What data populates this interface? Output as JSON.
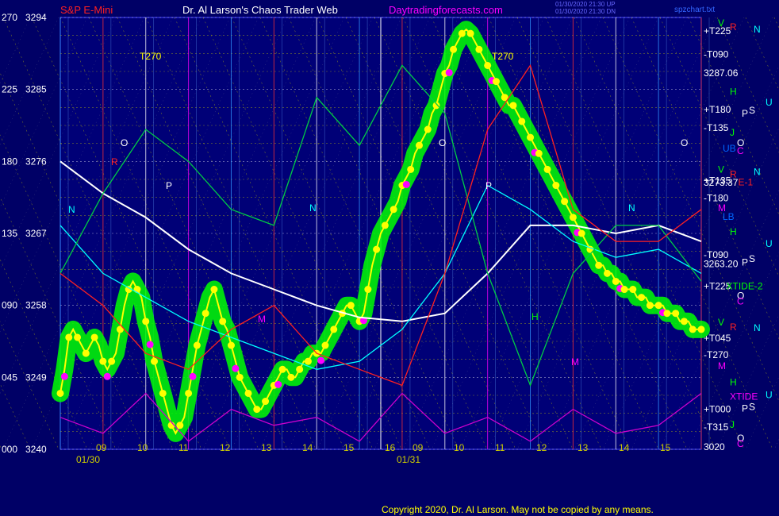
{
  "header": {
    "symbol": "S&P E-Mini",
    "title": "Dr. Al Larson's Chaos Trader Web",
    "site": "Daytradingforecasts.com",
    "timestamp_line1": "01/30/2020 21:30 UP",
    "timestamp_line2": "01/30/2020 21:30 DN",
    "file": "spzchart.txt"
  },
  "footer": {
    "copyright": "Copyright 2020, Dr. Al Larson. May not be copied by any means."
  },
  "colors": {
    "background": "#000066",
    "price_yellow": "#ffff00",
    "trend_green": "#00ff00",
    "avg_white": "#ffffff",
    "avg_cyan": "#00ffff",
    "magenta": "#ff00ff",
    "red": "#ff2020",
    "grid_yellow": "#c8c800",
    "vline_blue": "#3399ff",
    "vline_red": "#ff3030"
  },
  "chart_data": {
    "type": "line",
    "title": "S&P E-Mini",
    "ylim": [
      3240,
      3294
    ],
    "y_ticks_price": [
      "3294",
      "3285",
      "3276",
      "3267",
      "3258",
      "3249",
      "3240"
    ],
    "y_ticks_degrees": [
      "270",
      "225",
      "180",
      "135",
      "090",
      "045",
      "000"
    ],
    "x_date_labels": [
      "01/30",
      "01/31"
    ],
    "x_hour_labels_day1": [
      "09",
      "10",
      "11",
      "12",
      "13",
      "14",
      "15",
      "16"
    ],
    "x_hour_labels_day2": [
      "09",
      "10",
      "11",
      "12",
      "13",
      "14",
      "15"
    ],
    "right_labels": [
      {
        "text": "+T225",
        "price": 3292.3,
        "color": "#ffffff"
      },
      {
        "text": "-T090",
        "price": 3289.4,
        "color": "#ffffff"
      },
      {
        "text": "3287.06",
        "price": 3287.06,
        "color": "#ffffff"
      },
      {
        "text": "+T180",
        "price": 3282.5,
        "color": "#ffffff"
      },
      {
        "text": "-T135",
        "price": 3280.2,
        "color": "#ffffff"
      },
      {
        "text": "3273.37",
        "price": 3273.37,
        "color": "#ffffff"
      },
      {
        "text": "+T135",
        "price": 3273.6,
        "color": "#ffffff"
      },
      {
        "text": "-T180",
        "price": 3271.4,
        "color": "#ffffff"
      },
      {
        "text": "3263.20",
        "price": 3263.2,
        "color": "#ffffff"
      },
      {
        "text": "-T090",
        "price": 3264.3,
        "color": "#ffffff"
      },
      {
        "text": "+T225",
        "price": 3260.4,
        "color": "#ffffff"
      },
      {
        "text": "+T045",
        "price": 3253.9,
        "color": "#ffffff"
      },
      {
        "text": "-T270",
        "price": 3251.8,
        "color": "#ffffff"
      },
      {
        "text": "+T000",
        "price": 3245.0,
        "color": "#ffffff"
      },
      {
        "text": "-T315",
        "price": 3242.8,
        "color": "#ffffff"
      },
      {
        "text": "3020",
        "price": 3240.3,
        "color": "#ffffff"
      }
    ],
    "right_letters": [
      {
        "text": "V",
        "price": 3293.3,
        "color": "#00ff00",
        "col": 0
      },
      {
        "text": "R",
        "price": 3292.8,
        "color": "#ff2020",
        "col": 1
      },
      {
        "text": "N",
        "price": 3292.5,
        "color": "#00ffff",
        "col": 3
      },
      {
        "text": "H",
        "price": 3284.7,
        "color": "#00ff00",
        "col": 1
      },
      {
        "text": "U",
        "price": 3283.4,
        "color": "#00ffff",
        "col": 4
      },
      {
        "text": "P",
        "price": 3282.0,
        "color": "#ffffff",
        "col": 2
      },
      {
        "text": "S",
        "price": 3282.4,
        "color": "#ffffff",
        "col": 2.6
      },
      {
        "text": "J",
        "price": 3279.6,
        "color": "#00ff00",
        "col": 1
      },
      {
        "text": "O",
        "price": 3278.3,
        "color": "#ffffff",
        "col": 1.6
      },
      {
        "text": "UB",
        "price": 3277.6,
        "color": "#0066ff",
        "col": 0.4
      },
      {
        "text": "C",
        "price": 3277.3,
        "color": "#ff00ff",
        "col": 1.6
      },
      {
        "text": "V",
        "price": 3275.0,
        "color": "#00ff00",
        "col": 0
      },
      {
        "text": "R",
        "price": 3274.4,
        "color": "#ff2020",
        "col": 1
      },
      {
        "text": "N",
        "price": 3274.7,
        "color": "#00ffff",
        "col": 3
      },
      {
        "text": "E-1",
        "price": 3273.4,
        "color": "#ff2020",
        "col": 1.7
      },
      {
        "text": "M",
        "price": 3270.2,
        "color": "#ff00ff",
        "col": 0
      },
      {
        "text": "LB",
        "price": 3269.1,
        "color": "#0066ff",
        "col": 0.4
      },
      {
        "text": "H",
        "price": 3267.2,
        "color": "#00ff00",
        "col": 1
      },
      {
        "text": "U",
        "price": 3265.7,
        "color": "#00ffff",
        "col": 4
      },
      {
        "text": "P",
        "price": 3263.4,
        "color": "#ffffff",
        "col": 2
      },
      {
        "text": "S",
        "price": 3263.8,
        "color": "#ffffff",
        "col": 2.6
      },
      {
        "text": "XTIDE-2",
        "price": 3260.4,
        "color": "#00ff00",
        "col": 0.7
      },
      {
        "text": "O",
        "price": 3259.2,
        "color": "#ffffff",
        "col": 1.6
      },
      {
        "text": "C",
        "price": 3258.5,
        "color": "#ff00ff",
        "col": 1.6
      },
      {
        "text": "V",
        "price": 3255.9,
        "color": "#00ff00",
        "col": 0
      },
      {
        "text": "R",
        "price": 3255.3,
        "color": "#ff2020",
        "col": 1
      },
      {
        "text": "N",
        "price": 3255.2,
        "color": "#00ffff",
        "col": 3
      },
      {
        "text": "M",
        "price": 3250.4,
        "color": "#ff00ff",
        "col": 0
      },
      {
        "text": "H",
        "price": 3248.4,
        "color": "#00ff00",
        "col": 1
      },
      {
        "text": "XTIDE",
        "price": 3246.6,
        "color": "#ff00ff",
        "col": 1
      },
      {
        "text": "U",
        "price": 3246.8,
        "color": "#00ffff",
        "col": 4
      },
      {
        "text": "P",
        "price": 3245.1,
        "color": "#ffffff",
        "col": 2
      },
      {
        "text": "S",
        "price": 3245.3,
        "color": "#ffffff",
        "col": 2.6
      },
      {
        "text": "J",
        "price": 3243.1,
        "color": "#00ff00",
        "col": 1
      },
      {
        "text": "O",
        "price": 3241.4,
        "color": "#ffffff",
        "col": 1.6
      },
      {
        "text": "C",
        "price": 3240.7,
        "color": "#ff00ff",
        "col": 1.6
      }
    ],
    "in_chart_labels": [
      {
        "text": "T270",
        "color": "#ffff00"
      },
      {
        "text": "T270",
        "color": "#ffff00"
      },
      {
        "text": "O",
        "color": "#ffffff"
      },
      {
        "text": "O",
        "color": "#ffffff"
      },
      {
        "text": "O",
        "color": "#ffffff"
      },
      {
        "text": "P",
        "color": "#ffffff"
      },
      {
        "text": "P",
        "color": "#ffffff"
      },
      {
        "text": "N",
        "color": "#00ffff"
      },
      {
        "text": "N",
        "color": "#00ffff"
      },
      {
        "text": "N",
        "color": "#00ffff"
      },
      {
        "text": "M",
        "color": "#ff00ff"
      },
      {
        "text": "M",
        "color": "#ff00ff"
      },
      {
        "text": "H",
        "color": "#00ff00"
      },
      {
        "text": "R",
        "color": "#ff2020"
      }
    ],
    "series": [
      {
        "name": "price",
        "color": "#ffff00",
        "x": [
          0.0,
          0.05,
          0.1,
          0.15,
          0.2,
          0.25,
          0.3,
          0.35,
          0.4,
          0.45,
          0.5,
          0.55,
          0.6,
          0.65,
          0.7,
          0.75,
          0.8,
          0.85,
          0.9,
          0.95,
          1.0,
          1.05,
          1.1,
          1.15,
          1.2,
          1.25,
          1.3,
          1.35,
          1.4,
          1.45,
          1.5,
          1.55,
          1.6,
          1.65,
          1.7,
          1.75,
          1.8,
          1.85,
          1.9,
          1.95,
          2.0,
          2.05,
          2.1,
          2.15,
          2.2,
          2.25,
          2.3,
          2.35,
          2.4,
          2.45,
          2.5,
          2.55,
          2.6,
          2.65,
          2.7,
          2.75,
          2.8,
          2.85,
          2.9,
          2.95,
          3.0,
          3.05,
          3.1,
          3.15,
          3.2,
          3.25,
          3.3,
          3.35,
          3.4,
          3.45,
          3.5,
          3.55,
          3.6,
          3.65,
          3.7,
          3.75,
          3.8,
          3.85,
          3.9,
          3.95,
          4.0,
          4.05,
          4.1,
          4.15,
          4.2,
          4.25,
          4.3,
          4.35,
          4.4,
          4.45,
          4.5,
          4.55,
          4.6,
          4.65,
          4.7,
          4.75,
          4.8,
          4.85,
          4.9,
          4.95,
          5.0,
          5.05,
          5.1,
          5.15,
          5.2,
          5.25,
          5.3,
          5.35,
          5.4,
          5.45,
          5.5,
          5.55,
          5.6,
          5.65,
          5.7,
          5.75,
          5.8,
          5.85,
          5.9,
          5.95,
          6.0,
          6.05,
          6.1,
          6.15,
          6.2,
          6.25,
          6.3,
          6.35,
          6.4,
          6.45,
          6.5,
          6.55,
          6.6,
          6.65,
          6.7,
          6.75,
          6.8,
          6.85,
          6.9,
          6.95,
          7.0,
          7.05,
          7.1,
          7.15,
          7.2,
          7.25,
          7.3,
          7.35,
          7.4,
          7.45,
          7.5
        ],
        "y": [
          3247,
          3250,
          3254,
          3255,
          3254,
          3253,
          3252,
          3253,
          3254,
          3253,
          3251,
          3250,
          3251,
          3252,
          3255,
          3258,
          3260,
          3261,
          3260,
          3259,
          3256,
          3254,
          3251,
          3249,
          3247,
          3245,
          3243,
          3242,
          3243,
          3244,
          3247,
          3250,
          3253,
          3255,
          3257,
          3259,
          3260,
          3258,
          3256,
          3255,
          3253,
          3251,
          3249,
          3248,
          3247,
          3246,
          3245,
          3245,
          3246,
          3247,
          3248,
          3249,
          3250,
          3250,
          3249,
          3249,
          3250,
          3251,
          3251,
          3252,
          3252,
          3252,
          3253,
          3254,
          3255,
          3256,
          3257,
          3258,
          3258,
          3257,
          3256,
          3257,
          3260,
          3263,
          3265,
          3267,
          3268,
          3269,
          3270,
          3271,
          3273,
          3274,
          3275,
          3277,
          3278,
          3279,
          3280,
          3282,
          3283,
          3285,
          3287,
          3288,
          3290,
          3291,
          3292,
          3292.5,
          3292,
          3291,
          3290,
          3289,
          3288,
          3287,
          3286,
          3285,
          3284,
          3283,
          3283,
          3282,
          3281,
          3280,
          3279,
          3278,
          3277,
          3276,
          3275,
          3274,
          3273,
          3272,
          3271,
          3270,
          3269,
          3268,
          3267,
          3266,
          3265,
          3264,
          3263,
          3263,
          3262,
          3262,
          3261,
          3261,
          3260,
          3260,
          3260,
          3259,
          3259,
          3259,
          3258,
          3258,
          3258,
          3258,
          3257,
          3257,
          3257,
          3256,
          3256,
          3256,
          3255,
          3255,
          3255
        ]
      },
      {
        "name": "white_avg",
        "color": "#ffffff",
        "x": [
          0.0,
          0.5,
          1.0,
          1.5,
          2.0,
          2.5,
          3.0,
          3.5,
          4.0,
          4.5,
          5.0,
          5.5,
          6.0,
          6.5,
          7.0,
          7.5
        ],
        "y": [
          3276,
          3272,
          3269,
          3265,
          3262,
          3260,
          3258,
          3256.5,
          3256,
          3257,
          3262,
          3268,
          3268,
          3267,
          3268,
          3266
        ]
      },
      {
        "name": "cyan_avg",
        "color": "#00ffff",
        "x": [
          0.0,
          0.5,
          1.0,
          1.5,
          2.0,
          2.5,
          3.0,
          3.5,
          4.0,
          4.5,
          5.0,
          5.5,
          6.0,
          6.5,
          7.0,
          7.5
        ],
        "y": [
          3268,
          3262,
          3259,
          3256,
          3254,
          3252,
          3250,
          3251,
          3255,
          3262,
          3273,
          3270,
          3266,
          3264,
          3265,
          3262
        ]
      },
      {
        "name": "green_wave",
        "color": "#00cc44",
        "x": [
          0.0,
          0.5,
          1.0,
          1.5,
          2.0,
          2.5,
          3.0,
          3.5,
          4.0,
          4.5,
          5.0,
          5.5,
          6.0,
          6.5,
          7.0,
          7.5
        ],
        "y": [
          3262,
          3272,
          3280,
          3276,
          3270,
          3268,
          3284,
          3278,
          3288,
          3282,
          3262,
          3248,
          3262,
          3268,
          3268,
          3261
        ]
      },
      {
        "name": "red_wave",
        "color": "#ff2020",
        "x": [
          0.0,
          0.5,
          1.0,
          1.5,
          2.0,
          2.5,
          3.0,
          3.5,
          4.0,
          4.5,
          5.0,
          5.5,
          6.0,
          6.5,
          7.0,
          7.5
        ],
        "y": [
          3262,
          3258,
          3252,
          3250,
          3255,
          3258,
          3252,
          3250,
          3248,
          3262,
          3280,
          3288,
          3270,
          3266,
          3266,
          3270
        ]
      },
      {
        "name": "magenta_wave",
        "color": "#cc00cc",
        "x": [
          0.0,
          0.5,
          1.0,
          1.5,
          2.0,
          2.5,
          3.0,
          3.5,
          4.0,
          4.5,
          5.0,
          5.5,
          6.0,
          6.5,
          7.0,
          7.5
        ],
        "y": [
          3244,
          3242,
          3247,
          3241,
          3245,
          3243,
          3244,
          3241,
          3247,
          3242,
          3244,
          3241,
          3245,
          3242,
          3243,
          3247
        ]
      }
    ]
  }
}
